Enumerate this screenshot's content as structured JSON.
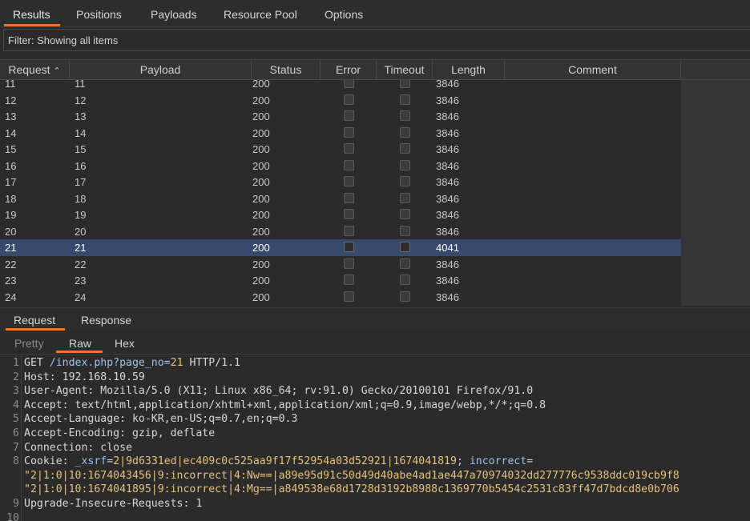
{
  "top_tabs": [
    "Results",
    "Positions",
    "Payloads",
    "Resource Pool",
    "Options"
  ],
  "filter": {
    "text": "Filter: Showing all items"
  },
  "table": {
    "columns": [
      "Request",
      "Payload",
      "Status",
      "Error",
      "Timeout",
      "Length",
      "Comment"
    ],
    "sort_indicator": "^",
    "rows": [
      {
        "request": "11",
        "payload": "11",
        "status": "200",
        "length": "3846"
      },
      {
        "request": "12",
        "payload": "12",
        "status": "200",
        "length": "3846"
      },
      {
        "request": "13",
        "payload": "13",
        "status": "200",
        "length": "3846"
      },
      {
        "request": "14",
        "payload": "14",
        "status": "200",
        "length": "3846"
      },
      {
        "request": "15",
        "payload": "15",
        "status": "200",
        "length": "3846"
      },
      {
        "request": "16",
        "payload": "16",
        "status": "200",
        "length": "3846"
      },
      {
        "request": "17",
        "payload": "17",
        "status": "200",
        "length": "3846"
      },
      {
        "request": "18",
        "payload": "18",
        "status": "200",
        "length": "3846"
      },
      {
        "request": "19",
        "payload": "19",
        "status": "200",
        "length": "3846"
      },
      {
        "request": "20",
        "payload": "20",
        "status": "200",
        "length": "3846"
      },
      {
        "request": "21",
        "payload": "21",
        "status": "200",
        "length": "4041",
        "selected": true
      },
      {
        "request": "22",
        "payload": "22",
        "status": "200",
        "length": "3846"
      },
      {
        "request": "23",
        "payload": "23",
        "status": "200",
        "length": "3846"
      },
      {
        "request": "24",
        "payload": "24",
        "status": "200",
        "length": "3846"
      }
    ]
  },
  "req_tabs": [
    "Request",
    "Response"
  ],
  "view_tabs": [
    "Pretty",
    "Raw",
    "Hex"
  ],
  "editor": {
    "line_numbers": [
      "1",
      "2",
      "3",
      "4",
      "5",
      "6",
      "7",
      "8",
      "",
      "",
      "9",
      "10"
    ],
    "lines": [
      {
        "parts": [
          [
            "k",
            "GET "
          ],
          [
            "path",
            "/index.php?page_no="
          ],
          [
            "num",
            "21"
          ],
          [
            "k",
            " HTTP/1.1"
          ]
        ]
      },
      {
        "parts": [
          [
            "k",
            "Host: 192.168.10.59"
          ]
        ]
      },
      {
        "parts": [
          [
            "k",
            "User-Agent: Mozilla/5.0 (X11; Linux x86_64; rv:91.0) Gecko/20100101 Firefox/91.0"
          ]
        ]
      },
      {
        "parts": [
          [
            "k",
            "Accept: text/html,application/xhtml+xml,application/xml;q=0.9,image/webp,*/*;q=0.8"
          ]
        ]
      },
      {
        "parts": [
          [
            "k",
            "Accept-Language: ko-KR,en-US;q=0.7,en;q=0.3"
          ]
        ]
      },
      {
        "parts": [
          [
            "k",
            "Accept-Encoding: gzip, deflate"
          ]
        ]
      },
      {
        "parts": [
          [
            "k",
            "Connection: close"
          ]
        ]
      },
      {
        "parts": [
          [
            "k",
            "Cookie: "
          ],
          [
            "ck",
            "_xsrf"
          ],
          [
            "k",
            "="
          ],
          [
            "num",
            "2|9d6331ed|ec409c0c525aa9f17f52954a03d52921|1674041819"
          ],
          [
            "k",
            "; "
          ],
          [
            "ck",
            "incorrect"
          ],
          [
            "k",
            "="
          ]
        ]
      },
      {
        "parts": [
          [
            "num",
            "\"2|1:0|10:1674043456|9:incorrect|4:Nw==|a89e95d91c50d49d40abe4ad1ae447a70974032dd277776c9538ddc019cb9f8"
          ]
        ]
      },
      {
        "parts": [
          [
            "num",
            "\"2|1:0|10:1674041895|9:incorrect|4:Mg==|a849538e68d1728d3192b8988c1369770b5454c2531c83ff47d7bdcd8e0b706"
          ]
        ]
      },
      {
        "parts": [
          [
            "k",
            "Upgrade-Insecure-Requests: 1"
          ]
        ]
      },
      {
        "parts": [
          [
            "k",
            ""
          ]
        ]
      }
    ]
  }
}
